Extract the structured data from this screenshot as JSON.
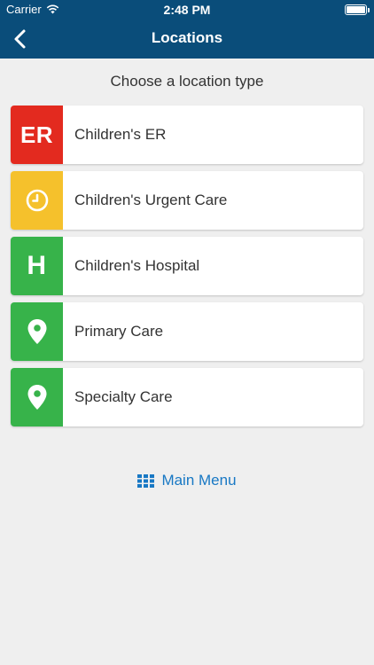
{
  "status_bar": {
    "carrier": "Carrier",
    "time": "2:48 PM"
  },
  "nav": {
    "title": "Locations",
    "back_icon": "chevron-left-icon"
  },
  "subtitle": "Choose a location type",
  "locations": [
    {
      "label": "Children's ER",
      "badge_text": "ER",
      "badge_color": "#e32a1f",
      "icon": "er-text-icon"
    },
    {
      "label": "Children's Urgent Care",
      "badge_text": "",
      "badge_color": "#f5c12c",
      "icon": "clock-icon"
    },
    {
      "label": "Children's Hospital",
      "badge_text": "H",
      "badge_color": "#37b34a",
      "icon": "hospital-h-icon"
    },
    {
      "label": "Primary Care",
      "badge_text": "",
      "badge_color": "#37b34a",
      "icon": "map-pin-icon"
    },
    {
      "label": "Specialty Care",
      "badge_text": "",
      "badge_color": "#37b34a",
      "icon": "map-pin-icon"
    }
  ],
  "main_menu": {
    "label": "Main Menu",
    "icon": "grid-icon",
    "color": "#1878c4"
  },
  "colors": {
    "header": "#0a4d7a",
    "background": "#efefef"
  }
}
